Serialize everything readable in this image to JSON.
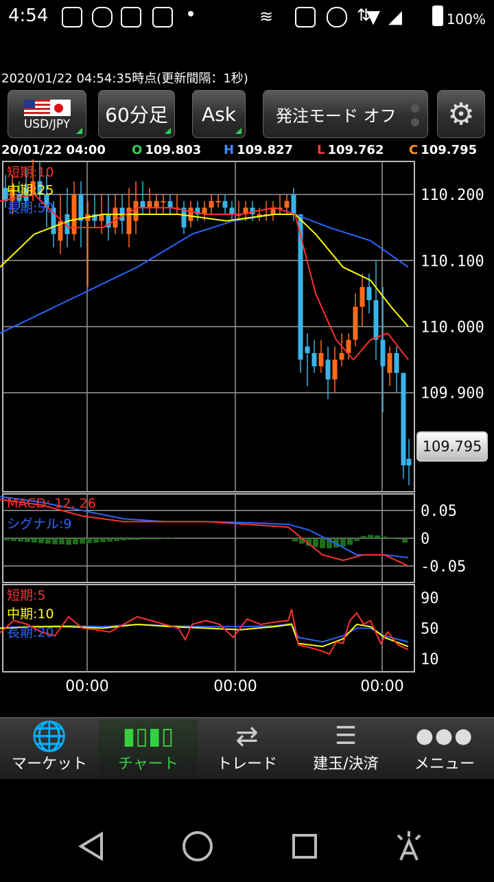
{
  "status_bar": {
    "time": "4:54",
    "battery": "100%"
  },
  "header": {
    "timestamp": "2020/01/22  04:54:35時点(更新間隔：1秒)",
    "pair": "USD/JPY",
    "interval": "60分足",
    "side": "Ask",
    "order_mode": "発注モード オフ"
  },
  "ohlc": {
    "date": "20/01/22 04:00",
    "open_key": "O",
    "open": "109.803",
    "high_key": "H",
    "high": "109.827",
    "low_key": "L",
    "low": "109.762",
    "close_key": "C",
    "close": "109.795"
  },
  "main_chart": {
    "ma_short": "短期:10",
    "ma_mid": "中期:25",
    "ma_long": "長期:50",
    "y_ticks": [
      "110.200",
      "110.100",
      "110.000",
      "109.900"
    ],
    "current_price": "109.795",
    "colors": {
      "up": "#ff6a1a",
      "down": "#3ab4e6",
      "short": "#ff3030",
      "mid": "#ffff00",
      "long": "#2a66ff"
    }
  },
  "macd_chart": {
    "label": "MACD: 12, 26",
    "signal_label": "シグナル:9",
    "y_ticks": [
      "0.05",
      "0",
      "-0.05"
    ]
  },
  "stoch_chart": {
    "short": "短期:5",
    "mid": "中期:10",
    "long": "長期:20",
    "y_ticks": [
      "90",
      "50",
      "10"
    ]
  },
  "x_ticks": [
    "00:00",
    "00:00",
    "00:00"
  ],
  "chart_data": {
    "type": "candlestick",
    "y_range": [
      109.75,
      110.25
    ],
    "ma_short_points": [
      [
        0,
        110.19
      ],
      [
        50,
        110.2
      ],
      [
        100,
        110.15
      ],
      [
        150,
        110.15
      ],
      [
        200,
        110.18
      ],
      [
        250,
        110.18
      ],
      [
        300,
        110.17
      ],
      [
        350,
        110.17
      ],
      [
        400,
        110.18
      ],
      [
        430,
        110.17
      ],
      [
        460,
        110.05
      ],
      [
        490,
        109.98
      ],
      [
        515,
        109.95
      ],
      [
        540,
        109.98
      ],
      [
        565,
        109.99
      ],
      [
        595,
        109.95
      ]
    ],
    "ma_mid_points": [
      [
        0,
        110.09
      ],
      [
        50,
        110.14
      ],
      [
        100,
        110.16
      ],
      [
        150,
        110.17
      ],
      [
        200,
        110.17
      ],
      [
        260,
        110.17
      ],
      [
        330,
        110.16
      ],
      [
        400,
        110.17
      ],
      [
        430,
        110.17
      ],
      [
        460,
        110.14
      ],
      [
        500,
        110.09
      ],
      [
        540,
        110.07
      ],
      [
        570,
        110.03
      ],
      [
        595,
        110.0
      ]
    ],
    "ma_long_points": [
      [
        0,
        109.99
      ],
      [
        100,
        110.04
      ],
      [
        200,
        110.09
      ],
      [
        280,
        110.14
      ],
      [
        340,
        110.16
      ],
      [
        400,
        110.17
      ],
      [
        430,
        110.17
      ],
      [
        480,
        110.15
      ],
      [
        540,
        110.13
      ],
      [
        595,
        110.09
      ]
    ],
    "candles": [
      [
        8,
        110.21,
        110.19,
        110.23,
        110.18
      ],
      [
        18,
        110.19,
        110.21,
        110.23,
        110.17
      ],
      [
        28,
        110.2,
        110.19,
        110.22,
        110.18
      ],
      [
        38,
        110.21,
        110.19,
        110.24,
        110.18
      ],
      [
        48,
        110.2,
        110.22,
        110.26,
        110.19
      ],
      [
        58,
        110.22,
        110.2,
        110.25,
        110.19
      ],
      [
        68,
        110.2,
        110.18,
        110.23,
        110.15
      ],
      [
        78,
        110.18,
        110.14,
        110.19,
        110.12
      ],
      [
        88,
        110.13,
        110.16,
        110.2,
        110.11
      ],
      [
        98,
        110.17,
        110.14,
        110.21,
        110.12
      ],
      [
        108,
        110.14,
        110.2,
        110.22,
        110.13
      ],
      [
        118,
        110.2,
        110.16,
        110.22,
        110.12
      ],
      [
        128,
        110.16,
        110.17,
        110.19,
        110.06
      ],
      [
        138,
        110.17,
        110.16,
        110.2,
        110.15
      ],
      [
        148,
        110.16,
        110.17,
        110.2,
        110.14
      ],
      [
        158,
        110.17,
        110.15,
        110.2,
        110.13
      ],
      [
        168,
        110.15,
        110.18,
        110.2,
        110.14
      ],
      [
        178,
        110.18,
        110.16,
        110.2,
        110.14
      ],
      [
        188,
        110.14,
        110.18,
        110.21,
        110.12
      ],
      [
        198,
        110.16,
        110.19,
        110.22,
        110.14
      ],
      [
        208,
        110.19,
        110.18,
        110.22,
        110.17
      ],
      [
        218,
        110.18,
        110.19,
        110.21,
        110.17
      ],
      [
        228,
        110.18,
        110.19,
        110.2,
        110.17
      ],
      [
        238,
        110.19,
        110.19,
        110.2,
        110.17
      ],
      [
        248,
        110.19,
        110.18,
        110.2,
        110.17
      ],
      [
        258,
        110.18,
        110.18,
        110.2,
        110.17
      ],
      [
        268,
        110.18,
        110.15,
        110.19,
        110.14
      ],
      [
        278,
        110.16,
        110.18,
        110.19,
        110.15
      ],
      [
        288,
        110.18,
        110.17,
        110.19,
        110.16
      ],
      [
        298,
        110.17,
        110.18,
        110.19,
        110.16
      ],
      [
        308,
        110.18,
        110.19,
        110.2,
        110.17
      ],
      [
        318,
        110.19,
        110.19,
        110.2,
        110.18
      ],
      [
        328,
        110.19,
        110.18,
        110.2,
        110.17
      ],
      [
        338,
        110.18,
        110.17,
        110.19,
        110.16
      ],
      [
        348,
        110.17,
        110.17,
        110.19,
        110.16
      ],
      [
        358,
        110.17,
        110.18,
        110.19,
        110.16
      ],
      [
        368,
        110.18,
        110.17,
        110.19,
        110.16
      ],
      [
        378,
        110.17,
        110.17,
        110.18,
        110.16
      ],
      [
        388,
        110.17,
        110.17,
        110.19,
        110.16
      ],
      [
        398,
        110.17,
        110.18,
        110.19,
        110.16
      ],
      [
        408,
        110.18,
        110.18,
        110.2,
        110.17
      ],
      [
        418,
        110.18,
        110.19,
        110.2,
        110.17
      ],
      [
        428,
        110.2,
        110.17,
        110.21,
        110.16
      ],
      [
        438,
        110.17,
        109.95,
        110.17,
        109.93
      ],
      [
        448,
        109.97,
        109.96,
        109.99,
        109.91
      ],
      [
        458,
        109.96,
        109.94,
        109.98,
        109.93
      ],
      [
        468,
        109.94,
        109.96,
        109.98,
        109.93
      ],
      [
        478,
        109.95,
        109.92,
        109.97,
        109.89
      ],
      [
        488,
        109.92,
        109.95,
        109.97,
        109.9
      ],
      [
        498,
        109.95,
        109.96,
        109.99,
        109.94
      ],
      [
        508,
        109.96,
        109.98,
        109.99,
        109.95
      ],
      [
        518,
        109.98,
        110.03,
        110.05,
        109.97
      ],
      [
        528,
        110.03,
        110.06,
        110.08,
        110.0
      ],
      [
        538,
        110.06,
        110.04,
        110.08,
        110.02
      ],
      [
        548,
        110.04,
        109.98,
        110.1,
        109.95
      ],
      [
        558,
        109.98,
        109.94,
        110.06,
        109.87
      ],
      [
        568,
        109.93,
        109.96,
        109.97,
        109.91
      ],
      [
        578,
        109.96,
        109.93,
        109.97,
        109.9
      ],
      [
        588,
        109.93,
        109.79,
        109.93,
        109.77
      ],
      [
        596,
        109.8,
        109.79,
        109.83,
        109.76
      ]
    ],
    "macd_range": [
      -0.08,
      0.08
    ],
    "macd_points": [
      [
        0,
        0.07
      ],
      [
        60,
        0.06
      ],
      [
        120,
        0.04
      ],
      [
        180,
        0.03
      ],
      [
        240,
        0.03
      ],
      [
        300,
        0.03
      ],
      [
        360,
        0.025
      ],
      [
        420,
        0.02
      ],
      [
        440,
        0.0
      ],
      [
        470,
        -0.03
      ],
      [
        500,
        -0.04
      ],
      [
        530,
        -0.03
      ],
      [
        560,
        -0.03
      ],
      [
        595,
        -0.05
      ]
    ],
    "signal_points": [
      [
        0,
        0.075
      ],
      [
        60,
        0.065
      ],
      [
        120,
        0.05
      ],
      [
        180,
        0.035
      ],
      [
        240,
        0.03
      ],
      [
        300,
        0.03
      ],
      [
        360,
        0.028
      ],
      [
        420,
        0.025
      ],
      [
        450,
        0.015
      ],
      [
        490,
        -0.01
      ],
      [
        520,
        -0.03
      ],
      [
        560,
        -0.03
      ],
      [
        595,
        -0.035
      ]
    ],
    "histogram": [
      [
        10,
        -0.004
      ],
      [
        20,
        -0.005
      ],
      [
        30,
        -0.006
      ],
      [
        40,
        -0.007
      ],
      [
        50,
        -0.008
      ],
      [
        60,
        -0.009
      ],
      [
        70,
        -0.01
      ],
      [
        80,
        -0.011
      ],
      [
        90,
        -0.011
      ],
      [
        100,
        -0.012
      ],
      [
        110,
        -0.011
      ],
      [
        120,
        -0.01
      ],
      [
        130,
        -0.009
      ],
      [
        140,
        -0.008
      ],
      [
        150,
        -0.007
      ],
      [
        160,
        -0.006
      ],
      [
        170,
        -0.005
      ],
      [
        180,
        -0.004
      ],
      [
        190,
        -0.003
      ],
      [
        200,
        -0.003
      ],
      [
        210,
        -0.002
      ],
      [
        220,
        -0.002
      ],
      [
        230,
        -0.002
      ],
      [
        240,
        -0.001
      ],
      [
        250,
        -0.001
      ],
      [
        430,
        -0.006
      ],
      [
        440,
        -0.01
      ],
      [
        450,
        -0.014
      ],
      [
        460,
        -0.016
      ],
      [
        470,
        -0.018
      ],
      [
        480,
        -0.018
      ],
      [
        490,
        -0.017
      ],
      [
        500,
        -0.015
      ],
      [
        510,
        -0.012
      ],
      [
        520,
        -0.005
      ],
      [
        530,
        0.004
      ],
      [
        540,
        0.006
      ],
      [
        550,
        0.005
      ],
      [
        560,
        0.003
      ],
      [
        570,
        0.001
      ],
      [
        580,
        -0.002
      ],
      [
        590,
        -0.008
      ]
    ],
    "stoch_range": [
      0,
      100
    ],
    "stoch_short": [
      [
        0,
        44
      ],
      [
        20,
        60
      ],
      [
        40,
        55
      ],
      [
        60,
        45
      ],
      [
        80,
        40
      ],
      [
        100,
        65
      ],
      [
        120,
        50
      ],
      [
        140,
        48
      ],
      [
        160,
        45
      ],
      [
        180,
        55
      ],
      [
        200,
        65
      ],
      [
        220,
        60
      ],
      [
        240,
        55
      ],
      [
        260,
        50
      ],
      [
        270,
        35
      ],
      [
        280,
        55
      ],
      [
        300,
        60
      ],
      [
        320,
        55
      ],
      [
        340,
        38
      ],
      [
        360,
        62
      ],
      [
        380,
        55
      ],
      [
        400,
        58
      ],
      [
        420,
        60
      ],
      [
        425,
        75
      ],
      [
        435,
        28
      ],
      [
        450,
        25
      ],
      [
        470,
        20
      ],
      [
        480,
        16
      ],
      [
        490,
        32
      ],
      [
        500,
        30
      ],
      [
        510,
        60
      ],
      [
        520,
        70
      ],
      [
        530,
        55
      ],
      [
        540,
        60
      ],
      [
        555,
        30
      ],
      [
        565,
        45
      ],
      [
        580,
        28
      ],
      [
        595,
        22
      ]
    ],
    "stoch_mid": [
      [
        0,
        50
      ],
      [
        50,
        52
      ],
      [
        100,
        52
      ],
      [
        150,
        50
      ],
      [
        200,
        55
      ],
      [
        250,
        52
      ],
      [
        300,
        50
      ],
      [
        350,
        48
      ],
      [
        400,
        52
      ],
      [
        425,
        55
      ],
      [
        435,
        30
      ],
      [
        470,
        26
      ],
      [
        500,
        36
      ],
      [
        520,
        55
      ],
      [
        540,
        52
      ],
      [
        560,
        38
      ],
      [
        595,
        26
      ]
    ],
    "stoch_long": [
      [
        0,
        50
      ],
      [
        50,
        52
      ],
      [
        100,
        53
      ],
      [
        150,
        52
      ],
      [
        200,
        55
      ],
      [
        250,
        53
      ],
      [
        300,
        52
      ],
      [
        350,
        52
      ],
      [
        400,
        53
      ],
      [
        425,
        56
      ],
      [
        435,
        38
      ],
      [
        470,
        32
      ],
      [
        500,
        40
      ],
      [
        520,
        50
      ],
      [
        540,
        50
      ],
      [
        560,
        40
      ],
      [
        595,
        32
      ]
    ]
  },
  "nav": [
    "マーケット",
    "チャート",
    "トレード",
    "建玉/決済",
    "メニュー"
  ]
}
